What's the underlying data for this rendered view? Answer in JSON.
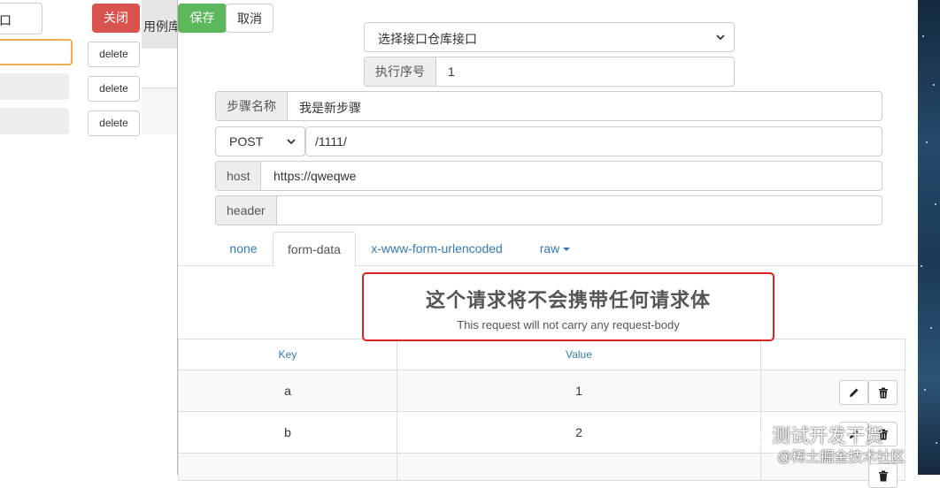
{
  "left_panel": {
    "top_button_label": "口",
    "close_label": "关闭",
    "delete_labels": [
      "delete",
      "delete",
      "delete"
    ]
  },
  "middle_tab": {
    "label": "用例库"
  },
  "modal": {
    "save_label": "保存",
    "cancel_label": "取消",
    "repo_select": {
      "value": "选择接口仓库接口"
    },
    "exec_order": {
      "label": "执行序号",
      "value": "1"
    },
    "step_name": {
      "label": "步骤名称",
      "value": "我是新步骤"
    },
    "method": {
      "value": "POST"
    },
    "path": {
      "value": "/1111/"
    },
    "host": {
      "label": "host",
      "value": "https://qweqwe"
    },
    "header": {
      "label": "header",
      "value": ""
    },
    "tabs": [
      {
        "label": "none"
      },
      {
        "label": "form-data"
      },
      {
        "label": "x-www-form-urlencoded"
      },
      {
        "label": "raw"
      }
    ],
    "active_tab": "form-data",
    "notice": {
      "cn": "这个请求将不会携带任何请求体",
      "en": "This request will not carry any request-body"
    },
    "table": {
      "headers": {
        "key": "Key",
        "value": "Value"
      },
      "rows": [
        {
          "key": "a",
          "value": "1"
        },
        {
          "key": "b",
          "value": "2"
        }
      ]
    }
  },
  "watermark": {
    "line1": "测试开发干货",
    "line2": "@稀土掘金技术社区"
  },
  "colors": {
    "save": "#5cb85c",
    "close": "#d9534f",
    "notice_border": "#e02020",
    "link": "#337ab7"
  }
}
